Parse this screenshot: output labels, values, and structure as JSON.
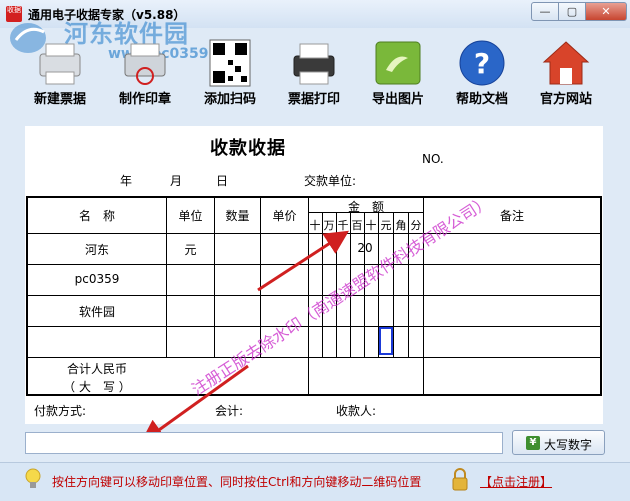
{
  "window": {
    "title": "通用电子收据专家（v5.88）",
    "min": "—",
    "max": "▢",
    "close": "✕"
  },
  "watermark": {
    "site": "河东软件园",
    "url": "www.pc0359.cn"
  },
  "toolbar": [
    {
      "id": "new",
      "label": "新建票据",
      "icon": "printer-icon"
    },
    {
      "id": "stamp",
      "label": "制作印章",
      "icon": "printer-stamp-icon"
    },
    {
      "id": "qrcode",
      "label": "添加扫码",
      "icon": "qr-code-icon"
    },
    {
      "id": "print",
      "label": "票据打印",
      "icon": "printer-icon"
    },
    {
      "id": "export",
      "label": "导出图片",
      "icon": "picture-icon"
    },
    {
      "id": "help",
      "label": "帮助文档",
      "icon": "help-icon"
    },
    {
      "id": "website",
      "label": "官方网站",
      "icon": "home-icon"
    }
  ],
  "receipt": {
    "title": "收款收据",
    "no_label": "NO.",
    "year": "年",
    "month": "月",
    "day": "日",
    "payer_label": "交款单位:",
    "headers": {
      "name": "名　称",
      "unit": "单位",
      "qty": "数量",
      "price": "单价",
      "amount": "金　额",
      "remark": "备注"
    },
    "digits": [
      "十",
      "万",
      "千",
      "百",
      "十",
      "元",
      "角",
      "分"
    ],
    "rows": [
      {
        "name": "河东",
        "unit": "元",
        "qty": "",
        "price": "",
        "amount": "20"
      },
      {
        "name": "pc0359",
        "unit": "",
        "qty": "",
        "price": "",
        "amount": ""
      },
      {
        "name": "软件园",
        "unit": "",
        "qty": "",
        "price": "",
        "amount": ""
      },
      {
        "name": "",
        "unit": "",
        "qty": "",
        "price": "",
        "amount": ""
      }
    ],
    "total_label_1": "合计人民币",
    "total_label_2": "（ 大　写 ）",
    "pay_method_label": "付款方式:",
    "accountant_label": "会计:",
    "payee_label": "收款人:"
  },
  "overlay_watermark": "注册正版去除水印（南通速盟软件科技有限公司）",
  "bottom": {
    "input_value": "",
    "bigdigit_button": "大写数字",
    "bigdigit_icon": "¥"
  },
  "status": {
    "hint": "按住方向键可以移动印章位置、同时按住Ctrl和方向键移动二维码位置",
    "register": "【点击注册】"
  }
}
